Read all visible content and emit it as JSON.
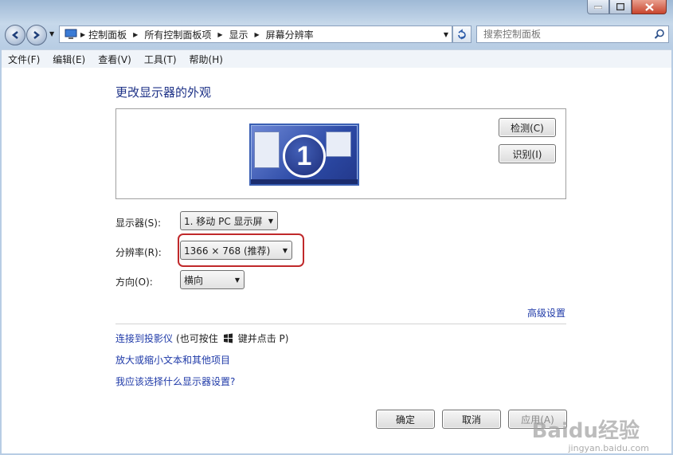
{
  "nav": {
    "breadcrumbs": [
      "控制面板",
      "所有控制面板项",
      "显示",
      "屏幕分辨率"
    ],
    "search_placeholder": "搜索控制面板"
  },
  "menu": [
    "文件(F)",
    "编辑(E)",
    "查看(V)",
    "工具(T)",
    "帮助(H)"
  ],
  "content": {
    "heading": "更改显示器的外观",
    "monitor_number": "1",
    "detect_button": "检测(C)",
    "identify_button": "识别(I)",
    "display_label": "显示器(S):",
    "display_value": "1. 移动 PC 显示屏",
    "resolution_label": "分辨率(R):",
    "resolution_value": "1366 × 768 (推荐)",
    "orientation_label": "方向(O):",
    "orientation_value": "横向",
    "advanced_link": "高级设置",
    "projector_link": "连接到投影仪",
    "projector_hint_pre": "(也可按住",
    "projector_hint_post": "键并点击 P)",
    "enlarge_link": "放大或缩小文本和其他项目",
    "which_setting_link": "我应该选择什么显示器设置?",
    "ok_button": "确定",
    "cancel_button": "取消",
    "apply_button": "应用(A)"
  },
  "watermark": {
    "logo": "Baidu经验",
    "url": "jingyan.baidu.com"
  },
  "colors": {
    "link": "#1f3aa8",
    "heading": "#1e3287",
    "highlight": "#c0292b"
  }
}
